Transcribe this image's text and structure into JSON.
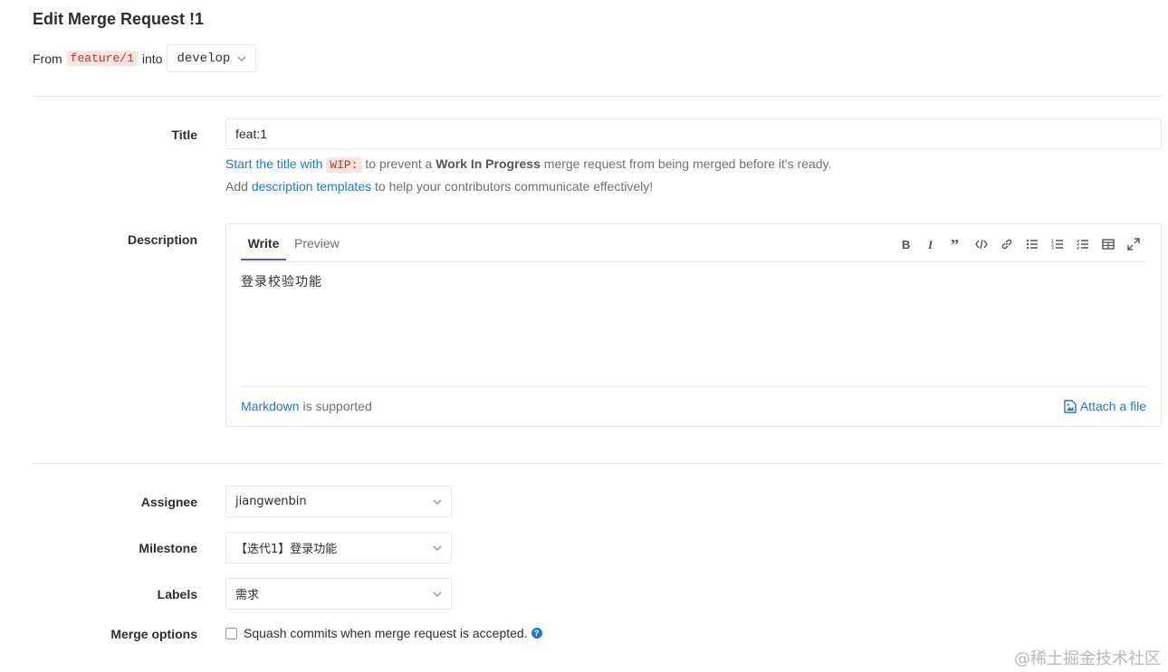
{
  "page": {
    "title": "Edit Merge Request !1"
  },
  "branches": {
    "from_label": "From",
    "source": "feature/1",
    "into_label": "into",
    "target": "develop"
  },
  "title_field": {
    "label": "Title",
    "value": "feat:1",
    "hint_start_link": "Start the title with",
    "hint_code": "WIP:",
    "hint_mid": "to prevent a",
    "hint_bold": "Work In Progress",
    "hint_end": "merge request from being merged before it's ready.",
    "templates_pre": "Add",
    "templates_link": "description templates",
    "templates_post": "to help your contributors communicate effectively!"
  },
  "description": {
    "label": "Description",
    "tabs": [
      "Write",
      "Preview"
    ],
    "active_tab": "Write",
    "content": "登录校验功能",
    "toolbar_icons": [
      "bold-icon",
      "italic-icon",
      "quote-icon",
      "code-icon",
      "link-icon",
      "bullet-list-icon",
      "numbered-list-icon",
      "task-list-icon",
      "table-icon",
      "fullscreen-icon"
    ],
    "markdown_link": "Markdown",
    "markdown_suffix": "is supported",
    "attach_label": "Attach a file"
  },
  "assignee": {
    "label": "Assignee",
    "value": "jiangwenbin"
  },
  "milestone": {
    "label": "Milestone",
    "value": "【迭代1】登录功能"
  },
  "labels": {
    "label": "Labels",
    "value": "需求"
  },
  "merge_options": {
    "label": "Merge options",
    "squash_text": "Squash commits when merge request is accepted.",
    "checked": false
  },
  "watermark": "@稀土掘金技术社区",
  "colors": {
    "accent": "#6b4fbb",
    "link": "#1f78d1",
    "code_bg": "#fbe5e1",
    "code_fg": "#c0341d"
  }
}
